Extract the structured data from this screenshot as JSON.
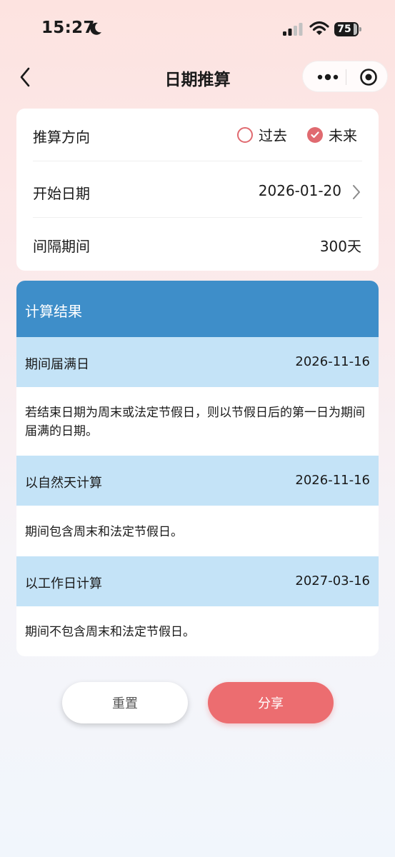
{
  "status_bar": {
    "time": "15:27",
    "battery": "75"
  },
  "nav": {
    "title": "日期推算"
  },
  "settings": {
    "direction": {
      "label": "推算方向",
      "options": [
        "过去",
        "未来"
      ],
      "selected": "未来"
    },
    "start_date": {
      "label": "开始日期",
      "value": "2026-01-20"
    },
    "interval": {
      "label": "间隔期间",
      "value": "300天"
    }
  },
  "results": {
    "title": "计算结果",
    "items": [
      {
        "label": "期间届满日",
        "value": "2026-11-16",
        "desc": "若结束日期为周末或法定节假日，则以节假日后的第一日为期间届满的日期。"
      },
      {
        "label": "以自然天计算",
        "value": "2026-11-16",
        "desc": "期间包含周末和法定节假日。"
      },
      {
        "label": "以工作日计算",
        "value": "2027-03-16",
        "desc": "期间不包含周末和法定节假日。"
      }
    ]
  },
  "buttons": {
    "reset": "重置",
    "share": "分享"
  },
  "colors": {
    "accent": "#e06a70",
    "header": "#3e8ec9",
    "band": "#c4e3f7",
    "share": "#ec6d70"
  },
  "icons": {
    "moon": "moon-icon",
    "signal": "signal-icon",
    "wifi": "wifi-icon",
    "battery": "battery-icon",
    "back": "chevron-left-icon",
    "more": "more-dots-icon",
    "target": "target-icon",
    "forward": "chevron-right-icon",
    "check": "check-icon"
  }
}
